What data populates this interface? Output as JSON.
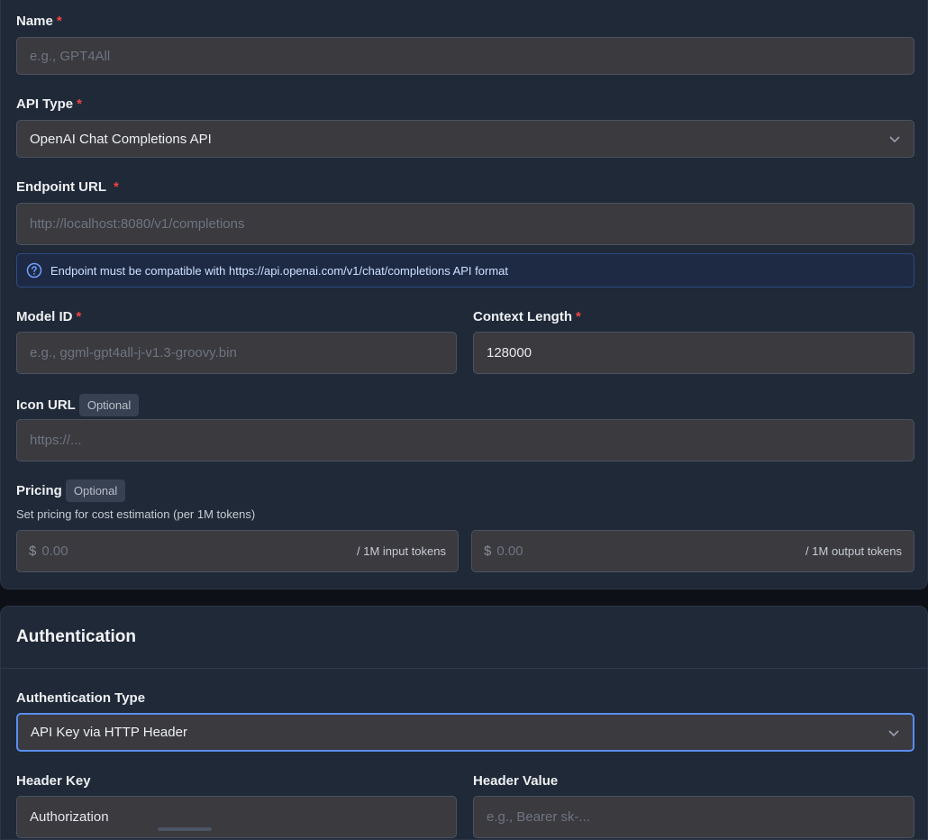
{
  "form": {
    "name": {
      "label": "Name",
      "placeholder": "e.g., GPT4All"
    },
    "api_type": {
      "label": "API Type",
      "value": "OpenAI Chat Completions API"
    },
    "endpoint": {
      "label": "Endpoint URL",
      "placeholder": "http://localhost:8080/v1/completions",
      "info": "Endpoint must be compatible with https://api.openai.com/v1/chat/completions API format"
    },
    "model_id": {
      "label": "Model ID",
      "placeholder": "e.g., ggml-gpt4all-j-v1.3-groovy.bin"
    },
    "context_length": {
      "label": "Context Length",
      "value": "128000"
    },
    "icon_url": {
      "label": "Icon URL",
      "badge": "Optional",
      "placeholder": "https://..."
    },
    "pricing": {
      "label": "Pricing",
      "badge": "Optional",
      "description": "Set pricing for cost estimation (per 1M tokens)",
      "currency": "$",
      "input_placeholder": "0.00",
      "input_suffix": "/ 1M input tokens",
      "output_placeholder": "0.00",
      "output_suffix": "/ 1M output tokens"
    },
    "required_mark": "*"
  },
  "auth": {
    "title": "Authentication",
    "type": {
      "label": "Authentication Type",
      "value": "API Key via HTTP Header"
    },
    "header_key": {
      "label": "Header Key",
      "value": "Authorization"
    },
    "header_value": {
      "label": "Header Value",
      "placeholder": "e.g., Bearer sk-..."
    }
  },
  "colors": {
    "background": "#0d1117",
    "card": "#1f2937",
    "input": "#3a3a3f",
    "required": "#ef4444",
    "focus": "#5b8def",
    "info_bg": "#1e2a44"
  }
}
